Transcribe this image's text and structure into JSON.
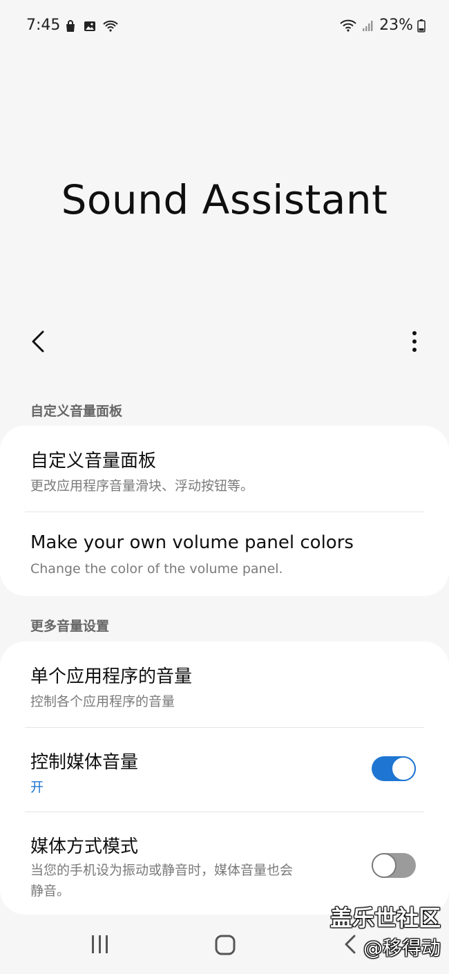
{
  "status_bar": {
    "time": "7:45",
    "battery": "23%",
    "left_icons": [
      "bag-icon",
      "image-icon",
      "wifi-calling-icon"
    ],
    "right_icons": [
      "wifi-icon",
      "signal-icon",
      "battery-icon"
    ]
  },
  "page": {
    "title": "Sound Assistant"
  },
  "toolbar": {
    "back_icon": "chevron-left-icon",
    "more_icon": "more-vert-icon"
  },
  "sections": [
    {
      "header": "自定义音量面板",
      "items": [
        {
          "title": "自定义音量面板",
          "subtitle": "更改应用程序音量滑块、浮动按钮等。"
        },
        {
          "title": "Make your own volume panel colors",
          "subtitle": "Change the color of the volume panel."
        }
      ]
    },
    {
      "header": "更多音量设置",
      "items": [
        {
          "title": "单个应用程序的音量",
          "subtitle": "控制各个应用程序的音量"
        },
        {
          "title": "控制媒体音量",
          "subtitle": "开",
          "toggle": true
        },
        {
          "title": "媒体方式模式",
          "subtitle_line1": "当您的手机设为振动或静音时，媒体音量也会",
          "subtitle_line2": "静音。",
          "toggle": false
        }
      ]
    }
  ],
  "nav_bar": {
    "icons": [
      "recent-apps-icon",
      "home-icon",
      "back-icon"
    ]
  },
  "watermark": {
    "line1": "盖乐世社区",
    "line2": "@移得动"
  },
  "colors": {
    "accent": "#1f76d2",
    "background": "#f6f6f6",
    "card": "#ffffff"
  }
}
